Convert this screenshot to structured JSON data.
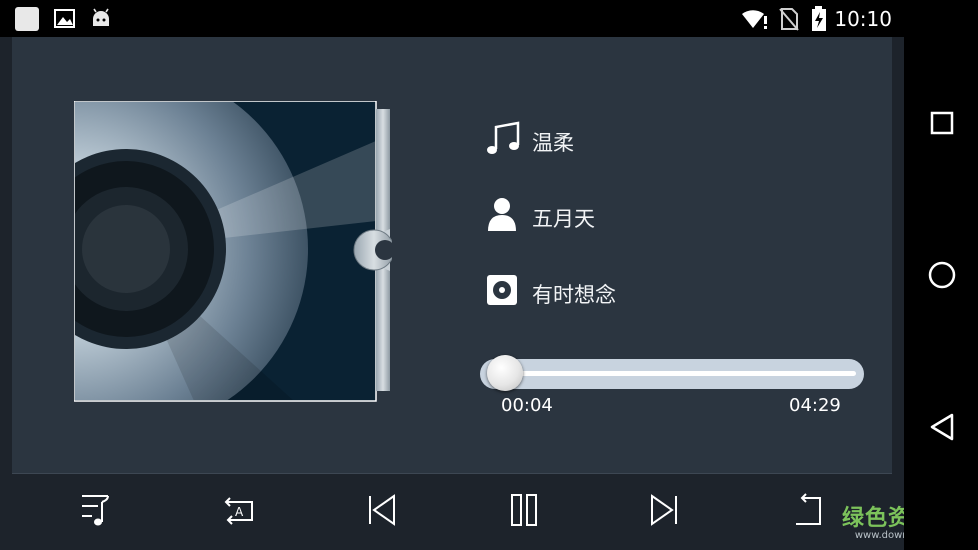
{
  "status_bar": {
    "time": "10:10",
    "left_icons": [
      "app-square-icon",
      "gallery-icon",
      "android-icon"
    ],
    "right_icons": [
      "wifi-icon",
      "no-sim-icon",
      "battery-charging-icon"
    ]
  },
  "track": {
    "title": "温柔",
    "artist": "五月天",
    "album": "有时想念"
  },
  "progress": {
    "current": "00:04",
    "total": "04:29",
    "fraction": 0.015
  },
  "controls": [
    "playlist-icon",
    "repeat-all-icon",
    "previous-icon",
    "pause-icon",
    "next-icon",
    "back-icon"
  ],
  "nav": [
    "recents-icon",
    "home-icon",
    "back-nav-icon"
  ],
  "watermark": {
    "main": "绿色资源网",
    "sub": "www.downcc.com"
  },
  "colors": {
    "panel": "#2b3540",
    "background": "#1d232b",
    "seek_track": "#c8d3df",
    "watermark": "#7cc35b"
  }
}
